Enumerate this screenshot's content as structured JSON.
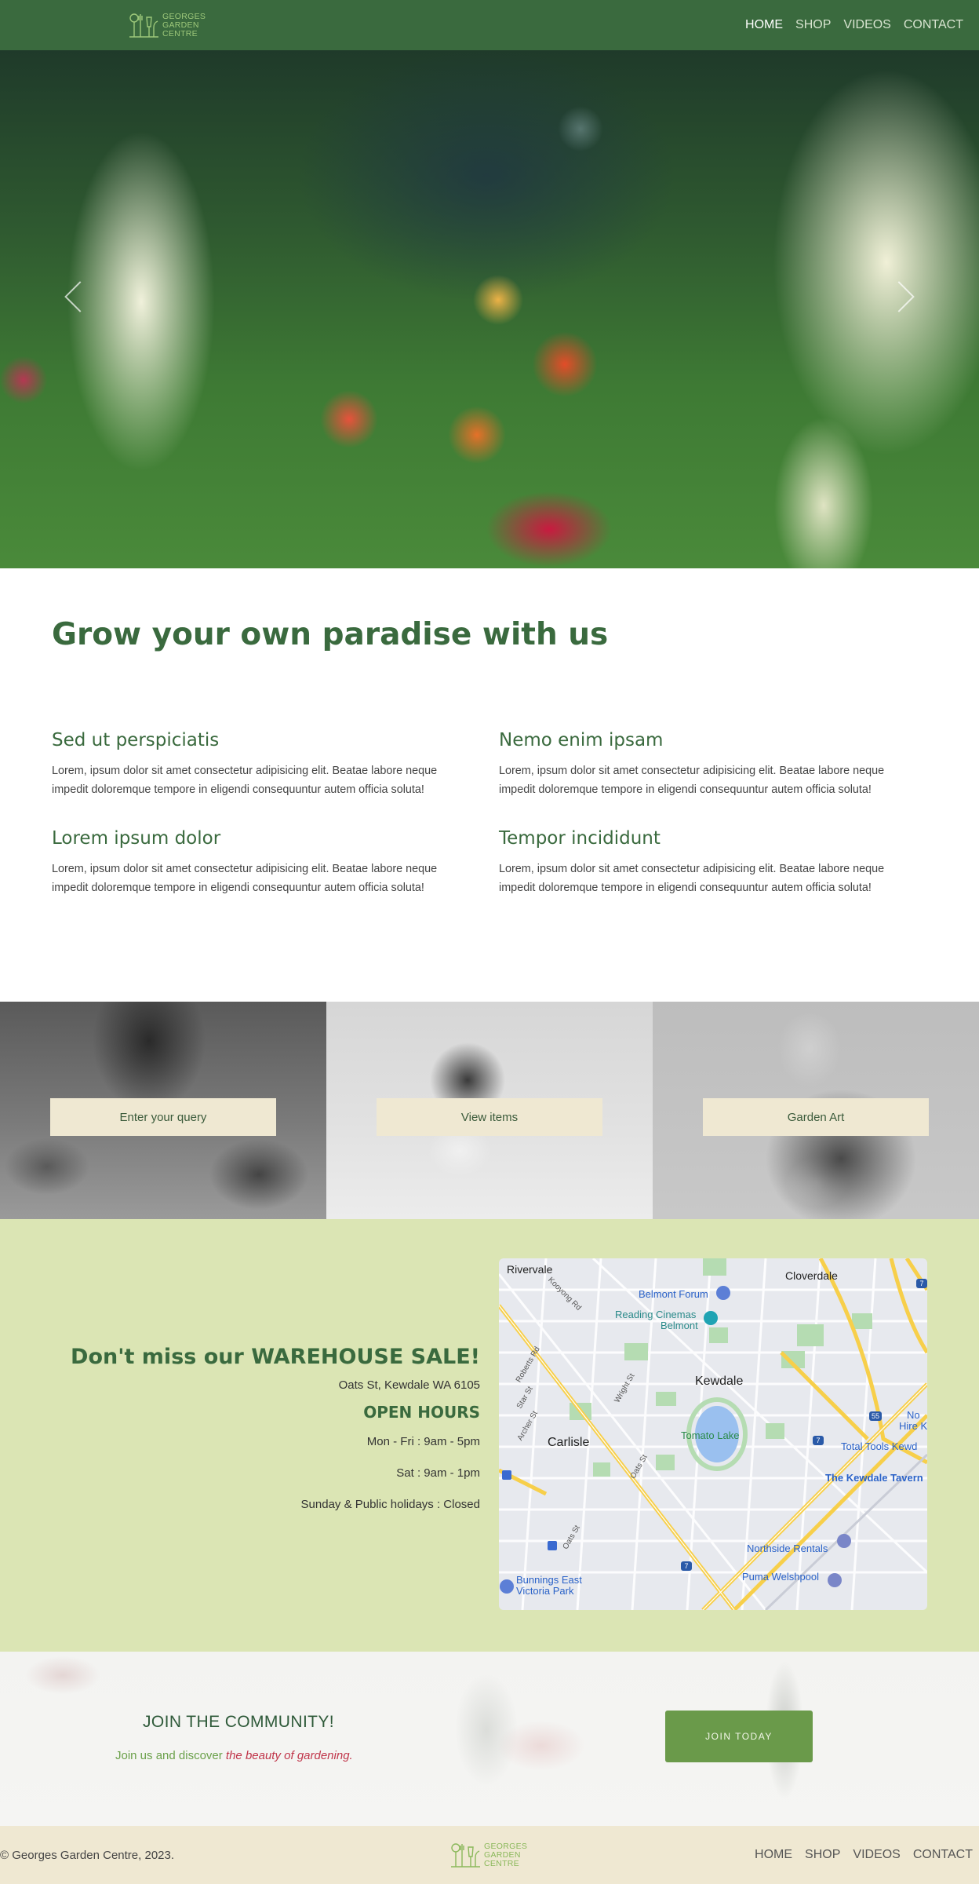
{
  "brand": {
    "logo_text": [
      "GEORGES",
      "GARDEN",
      "CENTRE"
    ]
  },
  "nav": {
    "items": [
      {
        "label": "HOME",
        "active": true
      },
      {
        "label": "SHOP",
        "active": false
      },
      {
        "label": "VIDEOS",
        "active": false
      },
      {
        "label": "CONTACT",
        "active": false
      }
    ]
  },
  "intro": {
    "title": "Grow your own paradise with us",
    "features": [
      {
        "title": "Sed ut perspiciatis",
        "text": "Lorem, ipsum dolor sit amet consectetur adipisicing elit. Beatae labore neque impedit doloremque tempore in eligendi consequuntur autem officia soluta!"
      },
      {
        "title": "Nemo enim ipsam",
        "text": "Lorem, ipsum dolor sit amet consectetur adipisicing elit. Beatae labore neque impedit doloremque tempore in eligendi consequuntur autem officia soluta!"
      },
      {
        "title": "Lorem ipsum dolor",
        "text": "Lorem, ipsum dolor sit amet consectetur adipisicing elit. Beatae labore neque impedit doloremque tempore in eligendi consequuntur autem officia soluta!"
      },
      {
        "title": "Tempor incididunt",
        "text": "Lorem, ipsum dolor sit amet consectetur adipisicing elit. Beatae labore neque impedit doloremque tempore in eligendi consequuntur autem officia soluta!"
      }
    ]
  },
  "cards": [
    {
      "button": "Enter your query"
    },
    {
      "button": "View items"
    },
    {
      "button": "Garden Art"
    }
  ],
  "sale": {
    "title": "Don't miss our WAREHOUSE SALE!",
    "address": "Oats St, Kewdale WA 6105",
    "hours_title": "OPEN HOURS",
    "hours": [
      "Mon - Fri : 9am - 5pm",
      "Sat : 9am - 1pm",
      "Sunday & Public holidays : Closed"
    ]
  },
  "map": {
    "places": {
      "rivervale": "Rivervale",
      "cloverdale": "Cloverdale",
      "belmont_forum": "Belmont Forum",
      "reading_cinemas": "Reading Cinemas",
      "belmont": "Belmont",
      "kewdale": "Kewdale",
      "tomato_lake": "Tomato Lake",
      "carlisle": "Carlisle",
      "total_tools": "Total Tools Kewd",
      "no_hire": "No",
      "hire": "Hire K",
      "kewdale_tavern": "The Kewdale Tavern",
      "northside_rentals": "Northside Rentals",
      "puma": "Puma Welshpool",
      "bunnings_1": "Bunnings East",
      "bunnings_2": "Victoria Park"
    },
    "streets": {
      "kooyong": "Kooyong Rd",
      "roberts": "Roberts Rd",
      "star": "Star St",
      "archer": "Archer St",
      "wright": "Wright St",
      "oats1": "Oats St",
      "oats2": "Oats St"
    },
    "route_badges": [
      "55",
      "7",
      "7",
      "7"
    ]
  },
  "community": {
    "title": "JOIN THE COMMUNITY!",
    "sub_plain": "Join us and discover ",
    "sub_em": "the beauty of gardening.",
    "button": "JOIN TODAY"
  },
  "footer": {
    "copyright": "© Georges Garden Centre, 2023.",
    "links": [
      "HOME",
      "SHOP",
      "VIDEOS",
      "CONTACT"
    ]
  },
  "colors": {
    "primary_green": "#3a6a3e",
    "sale_bg": "#dbe5b4",
    "cream": "#efe8d2",
    "button_green": "#6a9a4a",
    "accent_red": "#c0354a"
  }
}
